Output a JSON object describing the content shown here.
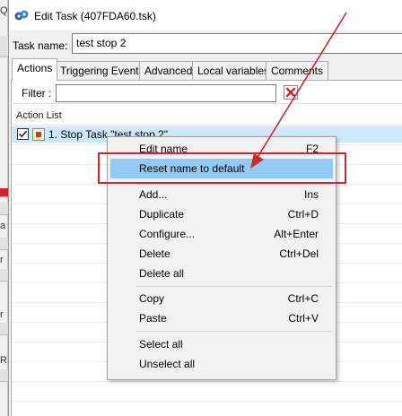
{
  "background_window": {
    "glyphs": [
      "Q",
      "a",
      "r",
      "r",
      "R"
    ]
  },
  "window": {
    "title": "Edit Task (407FDA60.tsk)",
    "task_name_label": "Task name:",
    "task_name_value": "test stop 2"
  },
  "tabs": [
    {
      "label": "Actions",
      "active": true
    },
    {
      "label": "Triggering Events",
      "active": false
    },
    {
      "label": "Advanced",
      "active": false
    },
    {
      "label": "Local variables",
      "active": false
    },
    {
      "label": "Comments",
      "active": false
    }
  ],
  "filter": {
    "label": "Filter :",
    "value": ""
  },
  "action_list": {
    "header": "Action List",
    "items": [
      {
        "text": "1. Stop Task \"test stop 2\"",
        "checked": true,
        "icon": "stop-task-icon"
      }
    ]
  },
  "context_menu": {
    "items": [
      {
        "label": "Edit name",
        "shortcut": "F2"
      },
      {
        "label": "Reset name to default",
        "shortcut": "",
        "highlighted": true
      },
      {
        "label": "Add...",
        "shortcut": "Ins"
      },
      {
        "label": "Duplicate",
        "shortcut": "Ctrl+D"
      },
      {
        "label": "Configure...",
        "shortcut": "Alt+Enter"
      },
      {
        "label": "Delete",
        "shortcut": "Ctrl+Del"
      },
      {
        "label": "Delete all",
        "shortcut": ""
      },
      {
        "label": "Copy",
        "shortcut": "Ctrl+C"
      },
      {
        "label": "Paste",
        "shortcut": "Ctrl+V"
      },
      {
        "label": "Select all",
        "shortcut": ""
      },
      {
        "label": "Unselect all",
        "shortcut": ""
      }
    ]
  },
  "colors": {
    "highlight": "#91c9f7",
    "annotation_red": "#d0242e",
    "selected_row": "#cde8ff"
  }
}
